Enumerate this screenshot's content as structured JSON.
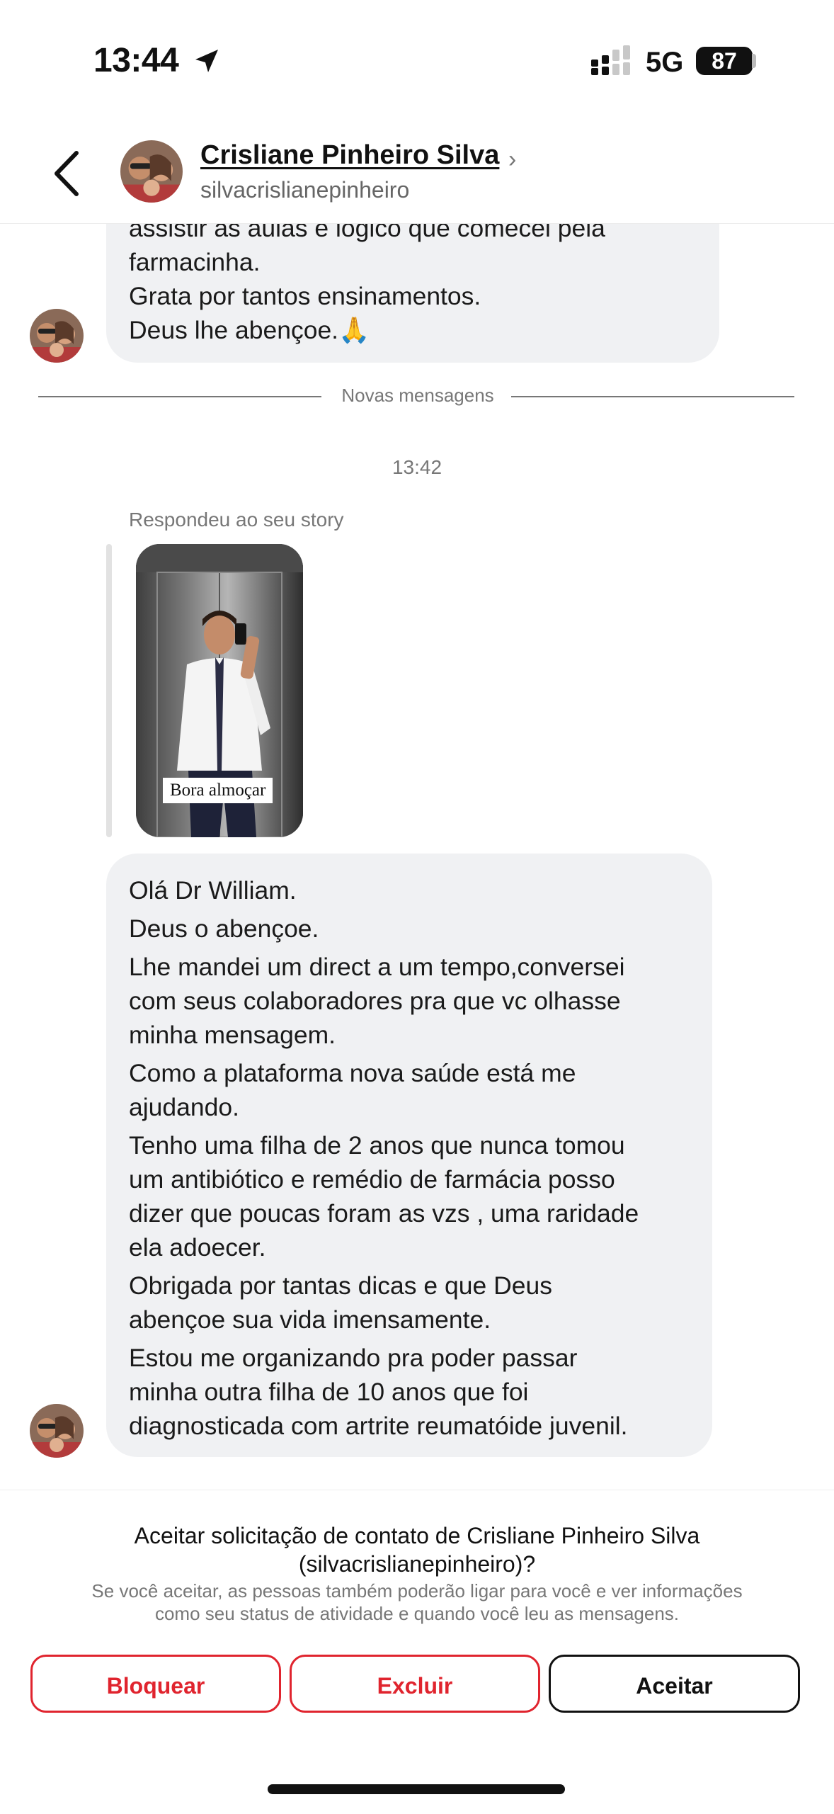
{
  "status": {
    "time": "13:44",
    "network": "5G",
    "battery": "87"
  },
  "header": {
    "name": "Crisliane Pinheiro Silva",
    "username": "silvacrislianepinheiro"
  },
  "thread": {
    "first_message_lines": [
      "assistir as aulas e logico que comecei pela",
      "farmacinha.",
      "Grata por tantos ensinamentos.",
      "Deus lhe abençoe.🙏"
    ],
    "divider": "Novas mensagens",
    "timestamp": "13:42",
    "reply_label": "Respondeu ao seu story",
    "story_caption": "Bora almoçar",
    "second_message_paragraphs": [
      [
        "Olá Dr William."
      ],
      [
        "Deus o abençoe."
      ],
      [
        "Lhe mandei um direct a um tempo,conversei",
        "com seus colaboradores pra que vc olhasse",
        "minha mensagem."
      ],
      [
        "Como a plataforma nova saúde está me",
        "ajudando."
      ],
      [
        "Tenho uma filha de 2 anos que nunca tomou",
        "um antibiótico e remédio de farmácia posso",
        "dizer que poucas foram as vzs , uma raridade",
        "ela adoecer."
      ],
      [
        "Obrigada por tantas dicas e que Deus",
        "abençoe sua vida imensamente."
      ],
      [
        "Estou me organizando pra poder passar",
        "minha outra filha de 10 anos que foi",
        "diagnosticada com artrite reumatóide juvenil."
      ]
    ]
  },
  "request": {
    "title_line1": "Aceitar solicitação de contato de Crisliane Pinheiro Silva",
    "title_line2": "(silvacrislianepinheiro)?",
    "subtitle_line1": "Se você aceitar, as pessoas também poderão ligar para você e ver informações",
    "subtitle_line2": "como seu status de atividade e quando você leu as mensagens.",
    "block_label": "Bloquear",
    "delete_label": "Excluir",
    "accept_label": "Aceitar"
  },
  "colors": {
    "danger": "#e0242e",
    "bubble": "#f0f1f3",
    "muted": "#777777"
  },
  "icons": [
    "location-arrow-icon",
    "signal-icon",
    "back-chevron-icon",
    "chevron-right-icon"
  ]
}
